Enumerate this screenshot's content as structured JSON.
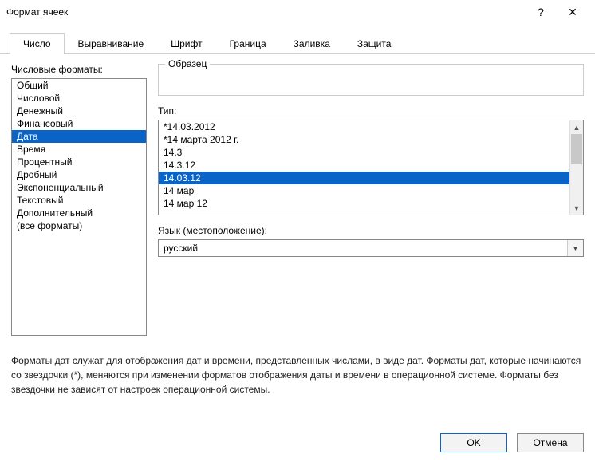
{
  "title": "Формат ячеек",
  "tabs": [
    "Число",
    "Выравнивание",
    "Шрифт",
    "Граница",
    "Заливка",
    "Защита"
  ],
  "activeTab": 0,
  "labels": {
    "categories": "Числовые форматы:",
    "sample": "Образец",
    "type": "Тип:",
    "language": "Язык (местоположение):"
  },
  "categories": [
    "Общий",
    "Числовой",
    "Денежный",
    "Финансовый",
    "Дата",
    "Время",
    "Процентный",
    "Дробный",
    "Экспоненциальный",
    "Текстовый",
    "Дополнительный",
    "(все форматы)"
  ],
  "selectedCategory": 4,
  "types": [
    "*14.03.2012",
    "*14 марта 2012 г.",
    "14.3",
    "14.3.12",
    "14.03.12",
    "14 мар",
    "14 мар 12"
  ],
  "selectedType": 4,
  "language": "русский",
  "description": "Форматы дат служат для отображения дат и времени, представленных числами, в виде дат. Форматы дат, которые начинаются со звездочки (*), меняются при изменении форматов отображения даты и времени в операционной системе. Форматы без звездочки не зависят от настроек операционной системы.",
  "buttons": {
    "ok": "OK",
    "cancel": "Отмена"
  }
}
